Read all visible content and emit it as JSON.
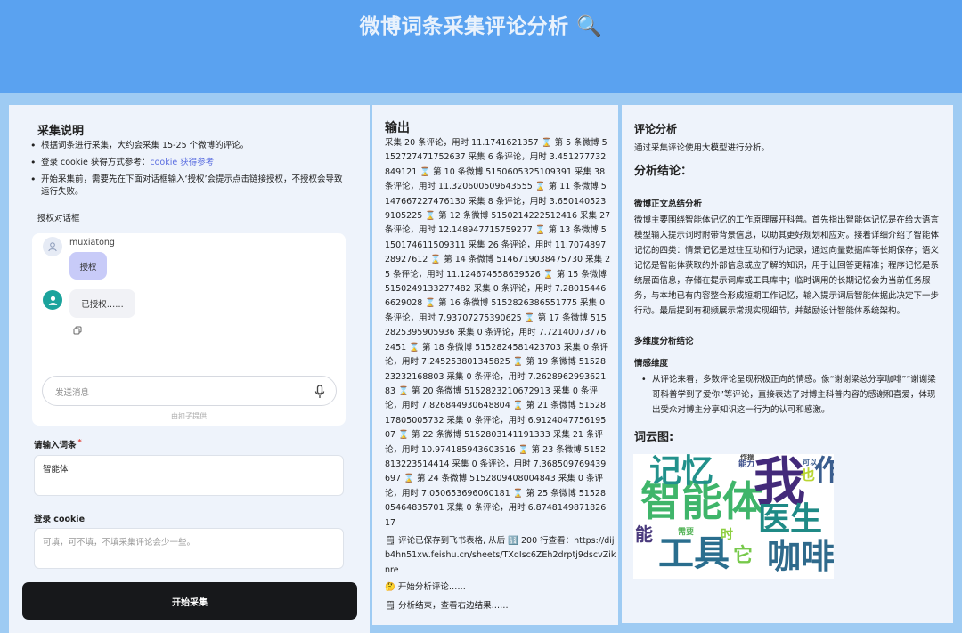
{
  "header": {
    "title": "微博词条采集评论分析 🔍"
  },
  "instructions": {
    "title": "采集说明",
    "items": [
      {
        "text": "根据词条进行采集，大约会采集 15-25 个微博的评论。"
      },
      {
        "text": "登录 cookie 获得方式参考：",
        "link": "cookie 获得参考"
      },
      {
        "text": "开始采集前，需要先在下面对话框输入‘授权’会提示点击链接授权，不授权会导致运行失败。"
      }
    ]
  },
  "auth_dialog": {
    "label": "授权对话框",
    "user_name": "muxiatong",
    "user_message": "授权",
    "bot_message": "已授权……",
    "input_placeholder": "发送消息",
    "powered_by": "由扣子提供"
  },
  "form": {
    "keyword_label": "请输入词条",
    "required_mark": "*",
    "keyword_value": "智能体",
    "cookie_label": "登录 cookie",
    "cookie_placeholder": "可填，可不填，不填采集评论会少一些。",
    "start_button": "开始采集"
  },
  "output": {
    "title": "输出",
    "log": "采集 20 条评论，用时 11.1741621357 ⌛ 第 5 条微博 5152727471752637 采集 6 条评论，用时 3.451277732849121 ⌛ 第 10 条微博 5150605325109391 采集 38 条评论，用时 11.320600509643555 ⌛ 第 11 条微博 5147667227476130 采集 8 条评论，用时 3.6501405239105225 ⌛ 第 12 条微博 5150214222512416 采集 27 条评论，用时 12.148947715759277 ⌛ 第 13 条微博 5150174611509311 采集 26 条评论，用时 11.707489728927612 ⌛ 第 14 条微博 5146719038475730 采集 25 条评论，用时 11.124674558639526 ⌛ 第 15 条微博 5150249133277482 采集 0 条评论，用时 7.280154466629028 ⌛ 第 16 条微博 5152826386551775 采集 0 条评论，用时 7.93707275390625 ⌛ 第 17 条微博 5152825395905936 采集 0 条评论，用时 7.721400737762451 ⌛ 第 18 条微博 5152824581423703 采集 0 条评论，用时 7.245253801345825 ⌛ 第 19 条微博 5152823232168803 采集 0 条评论，用时 7.262896299362183 ⌛ 第 20 条微博 5152823210672913 采集 0 条评论，用时 7.826844930648804 ⌛ 第 21 条微博 5152817805005732 采集 0 条评论，用时 6.912404775619507 ⌛ 第 22 条微博 5152803141191333 采集 21 条评论，用时 10.974185943603516 ⌛ 第 23 条微博 5152813223514414 采集 0 条评论，用时 7.368509769439697 ⌛ 第 24 条微博 5152809408004843 采集 0 条评论，用时 7.050653696060181 ⌛ 第 25 条微博 5152805464835701 采集 0 条评论，用时 6.874814987182617",
    "saved_line": "🗒 评论已保存到飞书表格, 从后 🔢 200 行查看：https://dijb4hn51xw.feishu.cn/sheets/TXqIsc6ZEh2drptj9dscvZiknre",
    "analyzing_line": "🤔 开始分析评论……",
    "done_line": "🗒 分析结束，查看右边结果……"
  },
  "analysis": {
    "title": "评论分析",
    "subtitle": "通过采集评论使用大模型进行分析。",
    "conclusion_heading": "分析结论：",
    "summary_heading": "微博正文总结分析",
    "summary_text": "微博主要围绕智能体记忆的工作原理展开科普。首先指出智能体记忆是在给大语言模型输入提示词时附带背景信息，以助其更好规划和应对。接着详细介绍了智能体记忆的四类：情景记忆是过往互动和行为记录，通过向量数据库等长期保存；语义记忆是智能体获取的外部信息或应了解的知识，用于让回答更精准；程序记忆是系统层面信息，存储在提示词库或工具库中；临时调用的长期记忆会为当前任务服务，与本地已有内容整合形成短期工作记忆，输入提示词后智能体据此决定下一步行动。最后提到有视频展示常规实现细节，并鼓励设计智能体系统架构。",
    "multi_heading": "多维度分析结论",
    "emotion_heading": "情感维度",
    "emotion_text": "从评论来看，多数评论呈现积极正向的情感。像“谢谢梁总分享咖啡”“谢谢梁哥科普学到了爱你”等评论，直接表达了对博主科普内容的感谢和喜爱，体现出受众对博主分享知识这一行为的认可和感激。",
    "wordcloud_heading": "词云图:"
  },
  "wordcloud": {
    "words": [
      {
        "text": "智能体",
        "color": "#3fb56a"
      },
      {
        "text": "我",
        "color": "#432a7a"
      },
      {
        "text": "记忆",
        "color": "#22918b"
      },
      {
        "text": "工具",
        "color": "#2a6e8e"
      },
      {
        "text": "咖啡",
        "color": "#2f6a8c"
      },
      {
        "text": "医生",
        "color": "#1f8a86"
      },
      {
        "text": "也",
        "color": "#b9d532"
      },
      {
        "text": "它",
        "color": "#77c94b"
      },
      {
        "text": "能力",
        "color": "#3a4d8a"
      },
      {
        "text": "作",
        "color": "#3a5d8e"
      },
      {
        "text": "作揣",
        "color": "#444"
      },
      {
        "text": "可以",
        "color": "#3a5d8e"
      },
      {
        "text": "需要",
        "color": "#56b45a"
      },
      {
        "text": "时",
        "color": "#8ccf3f"
      },
      {
        "text": "能",
        "color": "#4a3a7d"
      }
    ]
  }
}
